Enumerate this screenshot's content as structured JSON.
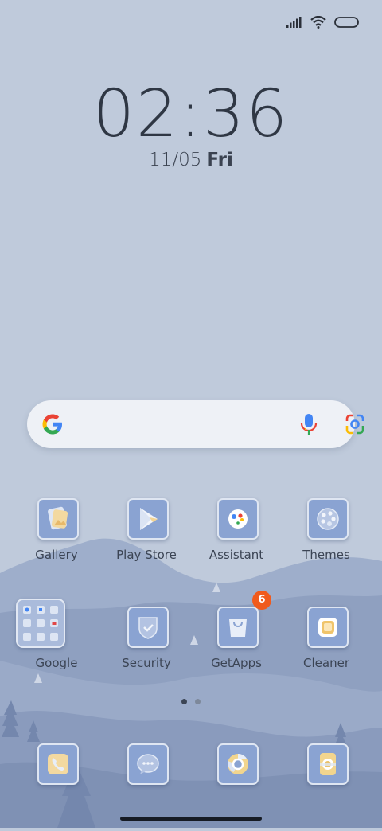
{
  "status": {
    "signal_icon": "signal-bars-icon",
    "wifi_icon": "wifi-icon",
    "battery_icon": "battery-icon"
  },
  "clock": {
    "time": "02:36",
    "date": "11/05",
    "weekday": "Fri"
  },
  "search": {
    "logo_icon": "google-g-icon",
    "voice_icon": "microphone-icon",
    "lens_icon": "google-lens-icon"
  },
  "apps": {
    "gallery": {
      "label": "Gallery",
      "icon": "gallery-icon"
    },
    "play_store": {
      "label": "Play Store",
      "icon": "play-store-icon"
    },
    "assistant": {
      "label": "Assistant",
      "icon": "assistant-icon"
    },
    "themes": {
      "label": "Themes",
      "icon": "palette-icon"
    },
    "google": {
      "label": "Google",
      "icon": "folder-icon"
    },
    "security": {
      "label": "Security",
      "icon": "shield-icon"
    },
    "getapps": {
      "label": "GetApps",
      "icon": "shopping-bag-icon",
      "badge": "6"
    },
    "cleaner": {
      "label": "Cleaner",
      "icon": "cleaner-icon"
    }
  },
  "dock": [
    {
      "name": "phone",
      "icon": "phone-icon"
    },
    {
      "name": "messages",
      "icon": "message-bubble-icon"
    },
    {
      "name": "browser",
      "icon": "chrome-browser-icon"
    },
    {
      "name": "camera",
      "icon": "camera-icon"
    }
  ],
  "page_indicator": {
    "pages": 2,
    "current": 1
  },
  "colors": {
    "background": "#bfcadb",
    "icon_tile": "#8aa3d2",
    "badge": "#f05a1c",
    "text": "#3b4454"
  }
}
